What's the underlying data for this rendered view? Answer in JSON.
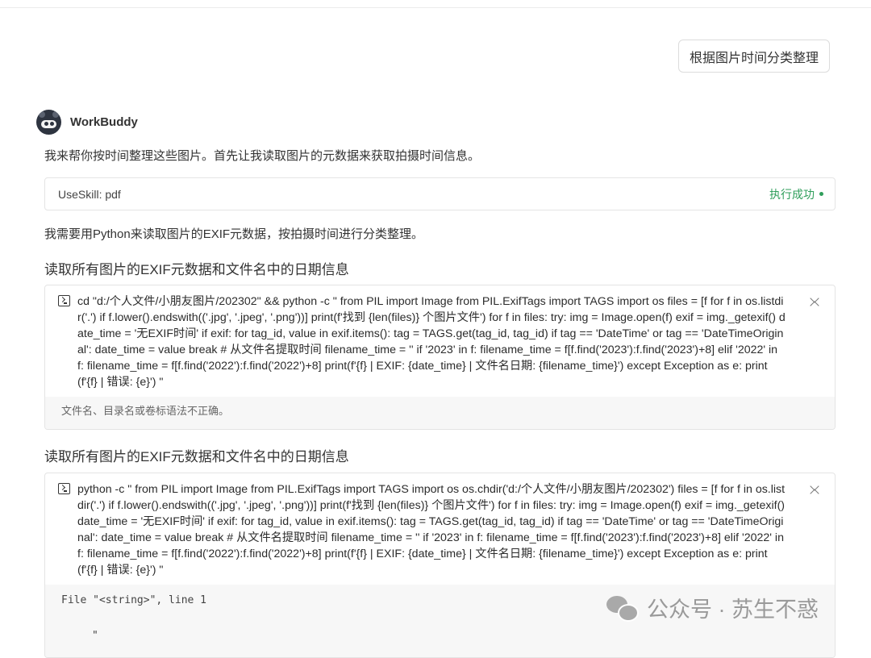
{
  "user_message": "根据图片时间分类整理",
  "assistant": {
    "name": "WorkBuddy"
  },
  "intro_text": "我来帮你按时间整理这些图片。首先让我读取图片的元数据来获取拍摄时间信息。",
  "skill": {
    "name": "UseSkill: pdf",
    "status": "执行成功"
  },
  "python_text": "我需要用Python来读取图片的EXIF元数据，按拍摄时间进行分类整理。",
  "steps": [
    {
      "heading": "读取所有图片的EXIF元数据和文件名中的日期信息",
      "command": "cd \"d:/个人文件/小朋友图片/202302\" && python -c \" from PIL import Image from PIL.ExifTags import TAGS import os files = [f for f in os.listdir('.') if f.lower().endswith(('.jpg', '.jpeg', '.png'))] print(f'找到 {len(files)} 个图片文件') for f in files: try: img = Image.open(f) exif = img._getexif() date_time = '无EXIF时间' if exif: for tag_id, value in exif.items(): tag = TAGS.get(tag_id, tag_id) if tag == 'DateTime' or tag == 'DateTimeOriginal': date_time = value break # 从文件名提取时间 filename_time = '' if '2023' in f: filename_time = f[f.find('2023'):f.find('2023')+8] elif '2022' in f: filename_time = f[f.find('2022'):f.find('2022')+8] print(f'{f} | EXIF: {date_time} | 文件名日期: {filename_time}') except Exception as e: print(f'{f} | 错误: {e}') \"",
      "output": "文件名、目录名或卷标语法不正确。"
    },
    {
      "heading": "读取所有图片的EXIF元数据和文件名中的日期信息",
      "command": "python -c \" from PIL import Image from PIL.ExifTags import TAGS import os os.chdir('d:/个人文件/小朋友图片/202302') files = [f for f in os.listdir('.') if f.lower().endswith(('.jpg', '.jpeg', '.png'))] print(f'找到 {len(files)} 个图片文件') for f in files: try: img = Image.open(f) exif = img._getexif() date_time = '无EXIF时间' if exif: for tag_id, value in exif.items(): tag = TAGS.get(tag_id, tag_id) if tag == 'DateTime' or tag == 'DateTimeOriginal': date_time = value break # 从文件名提取时间 filename_time = '' if '2023' in f: filename_time = f[f.find('2023'):f.find('2023')+8] elif '2022' in f: filename_time = f[f.find('2022'):f.find('2022')+8] print(f'{f} | EXIF: {date_time} | 文件名日期: {filename_time}') except Exception as e: print(f'{f} | 错误: {e}') \"",
      "output_line1": "File \"<string>\", line 1",
      "output_line2": "\""
    }
  ],
  "watermark": "公众号 · 苏生不惑",
  "colors": {
    "success": "#2f9e5b",
    "border": "#e4e4e4",
    "output_bg": "#f7f7f7"
  }
}
